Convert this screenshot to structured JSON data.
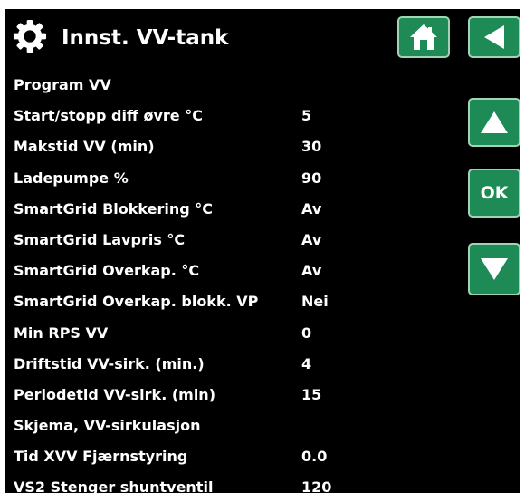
{
  "header": {
    "title": "Innst. VV-tank",
    "settings_icon": "gear-icon"
  },
  "nav": {
    "home_icon": "home-icon",
    "back_icon": "back-arrow-icon",
    "up_icon": "arrow-up-icon",
    "ok_label": "OK",
    "down_icon": "arrow-down-icon"
  },
  "colors": {
    "background": "#000000",
    "text": "#ffffff",
    "button": "#1e8a55",
    "button_border": "#9fd4b4"
  },
  "settings": [
    {
      "label": "Program VV",
      "value": ""
    },
    {
      "label": "Start/stopp diff øvre °C",
      "value": "5"
    },
    {
      "label": "Makstid VV (min)",
      "value": "30"
    },
    {
      "label": "Ladepumpe %",
      "value": "90"
    },
    {
      "label": "SmartGrid Blokkering °C",
      "value": "Av"
    },
    {
      "label": "SmartGrid Lavpris °C",
      "value": "Av"
    },
    {
      "label": "SmartGrid Overkap. °C",
      "value": "Av"
    },
    {
      "label": "SmartGrid Overkap. blokk. VP",
      "value": "Nei"
    },
    {
      "label": "Min RPS VV",
      "value": "0"
    },
    {
      "label": "Driftstid VV-sirk. (min.)",
      "value": "4"
    },
    {
      "label": "Periodetid VV-sirk. (min)",
      "value": "15"
    },
    {
      "label": "Skjema, VV-sirkulasjon",
      "value": ""
    },
    {
      "label": "Tid XVV Fjærnstyring",
      "value": "0.0"
    },
    {
      "label": "VS2 Stenger shuntventil",
      "value": "120"
    }
  ]
}
